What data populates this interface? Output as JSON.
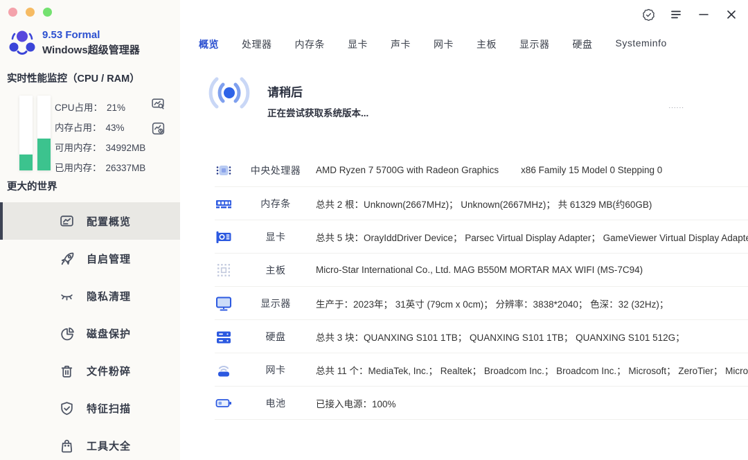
{
  "colors": {
    "accent_blue": "#2b50d0",
    "icon_blue": "#2c59e0",
    "bar_green": "#3cc38e",
    "sidebar_bg": "#fbfaf7",
    "active_item_bg": "#e9e8e4"
  },
  "window": {
    "traffic_lights": [
      "#f4a2ab",
      "#f6bb63",
      "#74e170"
    ]
  },
  "sidebar": {
    "version": "9.53 Formal",
    "app_name": "Windows超级管理器",
    "monitor_title": "实时性能监控（CPU / RAM）",
    "cpu_percent": 21,
    "ram_percent": 43,
    "stats": [
      {
        "label": "CPU占用：",
        "value": "21%"
      },
      {
        "label": "内存占用：",
        "value": "43%"
      },
      {
        "label": "可用内存：",
        "value": "34992MB"
      },
      {
        "label": "已用内存：",
        "value": "26337MB"
      }
    ],
    "world_label": "更大的世界",
    "menu": [
      {
        "label": "配置概览",
        "active": true
      },
      {
        "label": "自启管理",
        "active": false
      },
      {
        "label": "隐私清理",
        "active": false
      },
      {
        "label": "磁盘保护",
        "active": false
      },
      {
        "label": "文件粉碎",
        "active": false
      },
      {
        "label": "特征扫描",
        "active": false
      },
      {
        "label": "工具大全",
        "active": false
      }
    ]
  },
  "tabs": {
    "items": [
      "概览",
      "处理器",
      "内存条",
      "显卡",
      "声卡",
      "网卡",
      "主板",
      "显示器",
      "硬盘",
      "Systeminfo"
    ],
    "active": "概览"
  },
  "banner": {
    "title": "请稍后",
    "subtitle": "正在尝试获取系统版本...",
    "ellipsis": "......"
  },
  "rows": [
    {
      "label": "中央处理器",
      "value": "AMD Ryzen 7 5700G with Radeon Graphics",
      "extra": "x86 Family 15 Model 0 Stepping 0"
    },
    {
      "label": "内存条",
      "value": "总共 2 根：Unknown(2667MHz)；  Unknown(2667MHz)；  共 61329 MB(约60GB)",
      "extra": ""
    },
    {
      "label": "显卡",
      "value": "总共 5 块：OrayIddDriver Device；  Parsec Virtual Display Adapter；  GameViewer Virtual Display Adapter；",
      "extra": ""
    },
    {
      "label": "主板",
      "value": "Micro-Star International Co., Ltd.  MAG B550M MORTAR MAX WIFI (MS-7C94)",
      "extra": ""
    },
    {
      "label": "显示器",
      "value": "生产于：2023年；  31英寸 (79cm x 0cm)；  分辨率：3838*2040；  色深：32  (32Hz)；",
      "extra": ""
    },
    {
      "label": "硬盘",
      "value": "总共 3 块：QUANXING S101 1TB；  QUANXING S101 1TB；  QUANXING S101 512G；",
      "extra": ""
    },
    {
      "label": "网卡",
      "value": "总共 11 个：MediaTek, Inc.；  Realtek；  Broadcom Inc.；  Broadcom Inc.；  Microsoft；  ZeroTier；  Microsoft",
      "extra": ""
    },
    {
      "label": "电池",
      "value": "已接入电源：100%",
      "extra": ""
    }
  ]
}
